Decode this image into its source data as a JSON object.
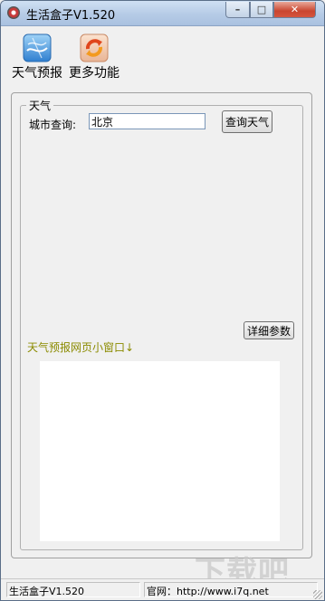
{
  "window": {
    "title": "生活盒子V1.520",
    "icon": "app-icon",
    "controls": {
      "minimize": "–",
      "maximize": "□",
      "close": "✕"
    }
  },
  "toolbar": {
    "weather_label": "天气预报",
    "more_label": "更多功能",
    "weather_icon": "weather-icon",
    "more_icon": "more-functions-icon"
  },
  "weather": {
    "group_title": "天气",
    "city_label": "城市查询:",
    "city_value": "北京",
    "query_button": "查询天气",
    "detail_button": "详细参数",
    "mini_window_label": "天气预报网页小窗口↓"
  },
  "status": {
    "left": "生活盒子V1.520",
    "right": "官网：http://www.i7q.net"
  },
  "watermark": "下载吧",
  "colors": {
    "accent_label": "#8b8b00",
    "close_button": "#c9452f",
    "titlebar": "#b6cbe6"
  }
}
